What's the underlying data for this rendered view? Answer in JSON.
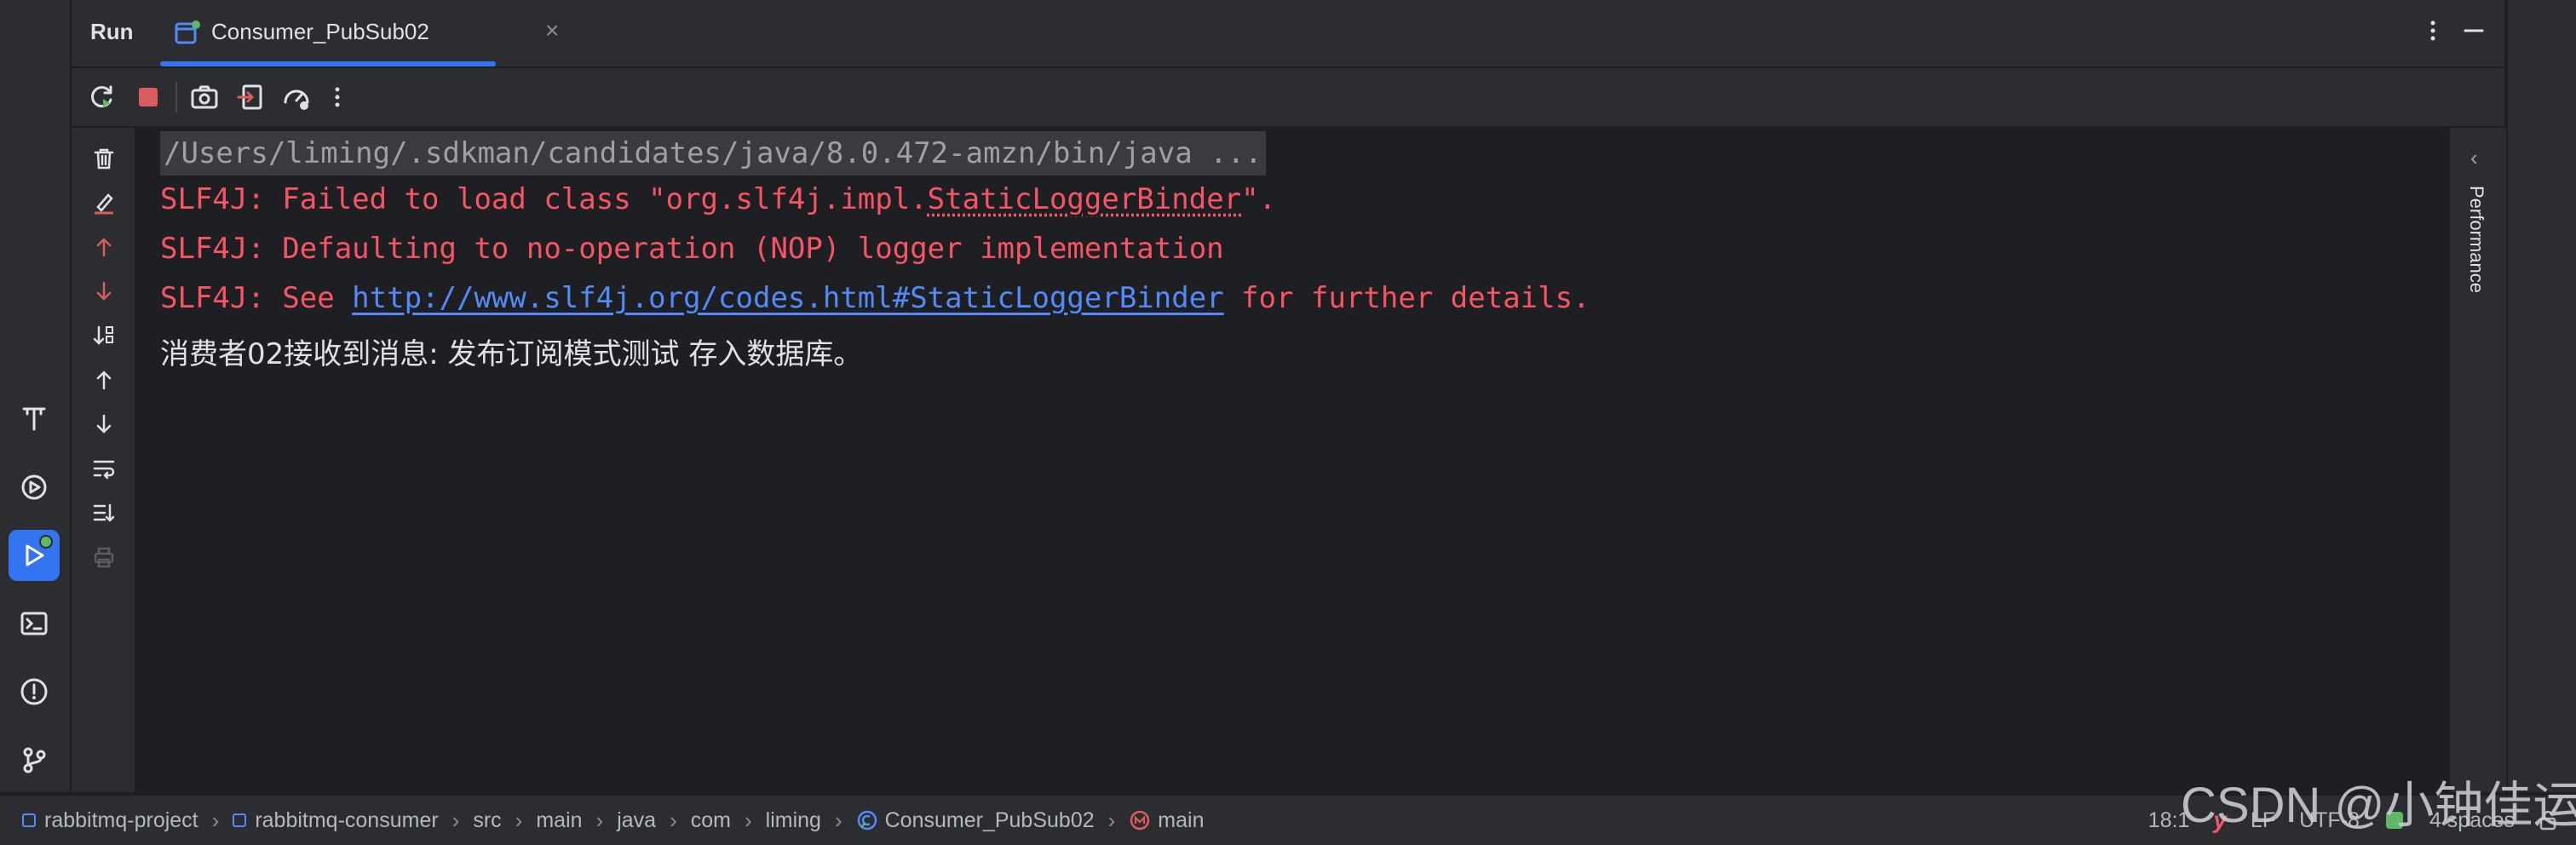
{
  "header": {
    "panel_title": "Run",
    "tab_label": "Consumer_PubSub02"
  },
  "console": {
    "command": "/Users/liming/.sdkman/candidates/java/8.0.472-amzn/bin/java ...",
    "lines": [
      {
        "prefix": "SLF4J: Failed to load class \"org.slf4j.impl.",
        "underlined": "StaticLoggerBinder",
        "suffix": "\"."
      },
      {
        "text": "SLF4J: Defaulting to no-operation (NOP) logger implementation"
      },
      {
        "prefix": "SLF4J: See ",
        "link": "http://www.slf4j.org/codes.html#StaticLoggerBinder",
        "suffix": " for further details."
      },
      {
        "text": "消费者02接收到消息: 发布订阅模式测试 存入数据库。"
      }
    ]
  },
  "right_panel": {
    "chevron": "‹",
    "label": "Performance"
  },
  "status_bar": {
    "breadcrumbs": [
      "rabbitmq-project",
      "rabbitmq-consumer",
      "src",
      "main",
      "java",
      "com",
      "liming",
      "Consumer_PubSub02",
      "main"
    ],
    "position": "18:1",
    "line_separator": "LF",
    "encoding": "UTF-8",
    "indent": "4 spaces"
  },
  "watermark": "CSDN @小钟佳运",
  "colors": {
    "background": "#1e1f22",
    "panel": "#2b2d30",
    "accent": "#3574f0",
    "error_text": "#f75464",
    "link": "#548af7"
  }
}
